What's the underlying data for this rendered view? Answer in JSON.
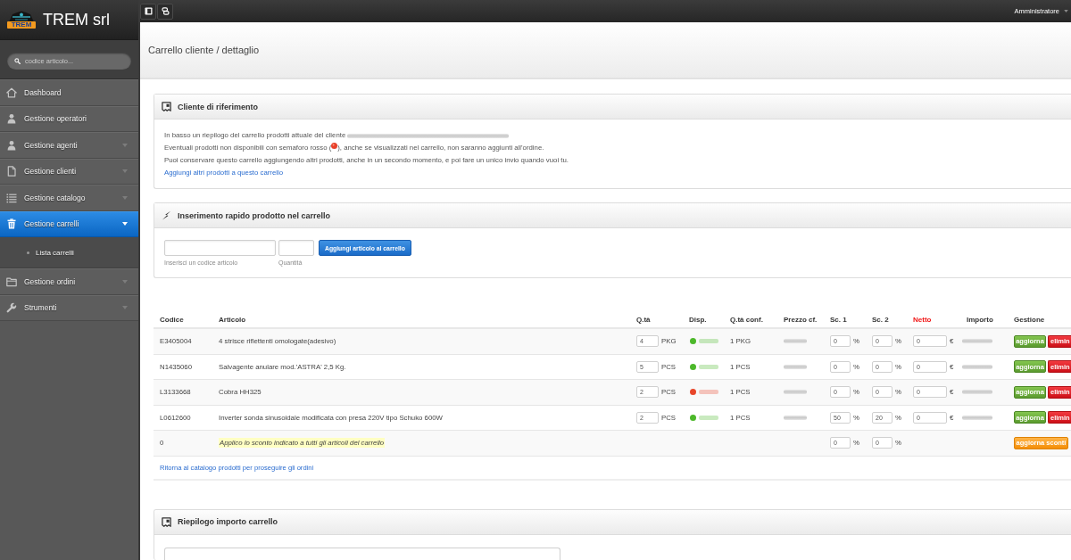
{
  "sidebar": {
    "brand": "TREM srl",
    "logo_text": "TREM",
    "search": {
      "placeholder": "codice articolo..."
    },
    "items": [
      {
        "label": "Dashboard",
        "expandable": false,
        "selected": false
      },
      {
        "label": "Gestione operatori",
        "expandable": false,
        "selected": false
      },
      {
        "label": "Gestione agenti",
        "expandable": true,
        "selected": false
      },
      {
        "label": "Gestione clienti",
        "expandable": true,
        "selected": false
      },
      {
        "label": "Gestione catalogo",
        "expandable": true,
        "selected": false
      },
      {
        "label": "Gestione carrelli",
        "expandable": true,
        "selected": true,
        "children": [
          {
            "label": "Lista carrelli",
            "selected": false
          }
        ]
      },
      {
        "label": "Gestione ordini",
        "expandable": true,
        "selected": false
      },
      {
        "label": "Strumenti",
        "expandable": true,
        "selected": false
      }
    ]
  },
  "topbar": {
    "user_menu": "Amministratore"
  },
  "page_title": "Carrello cliente / dettaglio",
  "customer_panel": {
    "title": "Cliente di riferimento",
    "intro": "In basso un riepilogo del carrello prodotti attuale del cliente",
    "warning_before": "Eventuali prodotti non disponibili con semaforo rosso (",
    "warning_after": "), anche se visualizzati nel carrello, non saranno aggiunti all'ordine.",
    "note": "Puoi conservare questo carrello aggiungendo altri prodotti, anche in un secondo momento, e poi fare un unico invio quando vuoi tu.",
    "link": "Aggiungi altri prodotti a questo carrello"
  },
  "quick_add_panel": {
    "title": "Inserimento rapido prodotto nel carrello",
    "code_caption": "Inserisci un codice articolo",
    "quantity_caption": "Quantità",
    "button": "Aggiungi articolo al carrello"
  },
  "cart_table": {
    "columns": [
      {
        "label": "Codice",
        "highlighted": false
      },
      {
        "label": "Articolo",
        "highlighted": false
      },
      {
        "label": "Q.tà",
        "highlighted": false
      },
      {
        "label": "Disp.",
        "highlighted": false
      },
      {
        "label": "Q.tà conf.",
        "highlighted": false
      },
      {
        "label": "Prezzo cf.",
        "highlighted": false
      },
      {
        "label": "Sc. 1",
        "highlighted": false
      },
      {
        "label": "Sc. 2",
        "highlighted": false
      },
      {
        "label": "Netto",
        "highlighted": true
      },
      {
        "label": "Importo",
        "highlighted": false
      },
      {
        "label": "Gestione",
        "highlighted": false
      }
    ],
    "rows": [
      {
        "kind": "item",
        "code": "E3405004",
        "article": "4 strisce riflettenti omologate(adesivo)",
        "qty": "4",
        "unit": "PKG",
        "color": "#4cb82a",
        "pack": "1 PKG",
        "discount_1": "0",
        "discount_1_suffix": "%",
        "discount_2": "0",
        "discount_2_suffix": "%",
        "net": "0",
        "net_suffix": "€",
        "update_button": "aggiorna",
        "delete_button": "elimin"
      },
      {
        "kind": "item",
        "code": "N1435060",
        "article": "Salvagente anulare mod.'ASTRA' 2,5 Kg.",
        "qty": "5",
        "unit": "PCS",
        "color": "#4cb82a",
        "pack": "1 PCS",
        "discount_1": "0",
        "discount_1_suffix": "%",
        "discount_2": "0",
        "discount_2_suffix": "%",
        "net": "0",
        "net_suffix": "€",
        "update_button": "aggiorna",
        "delete_button": "elimin"
      },
      {
        "kind": "item",
        "code": "L3133668",
        "article": "Cobra HH325",
        "qty": "2",
        "unit": "PCS",
        "color": "#e8462a",
        "pack": "1 PCS",
        "discount_1": "0",
        "discount_1_suffix": "%",
        "discount_2": "0",
        "discount_2_suffix": "%",
        "net": "0",
        "net_suffix": "€",
        "update_button": "aggiorna",
        "delete_button": "elimin"
      },
      {
        "kind": "item",
        "code": "L0612600",
        "article": "Inverter sonda sinusoidale modificata con presa 220V tipo Schuko 600W",
        "qty": "2",
        "unit": "PCS",
        "color": "#4cb82a",
        "pack": "1 PCS",
        "discount_1": "50",
        "discount_1_suffix": "%",
        "discount_2": "20",
        "discount_2_suffix": "%",
        "net": "0",
        "net_suffix": "€",
        "update_button": "aggiorna",
        "delete_button": "elimin"
      },
      {
        "kind": "bulk_discount",
        "code": "0",
        "note": "Applico lo sconto indicato a tutti gli articoli del carrello",
        "discount_1": "0",
        "discount_1_suffix": "%",
        "discount_2": "0",
        "discount_2_suffix": "%",
        "button": "aggiorna sconti"
      }
    ],
    "return_link": "Ritorna al catalogo prodotti per proseguire gli ordini"
  },
  "summary_panel": {
    "title": "Riepilogo importo carrello"
  }
}
